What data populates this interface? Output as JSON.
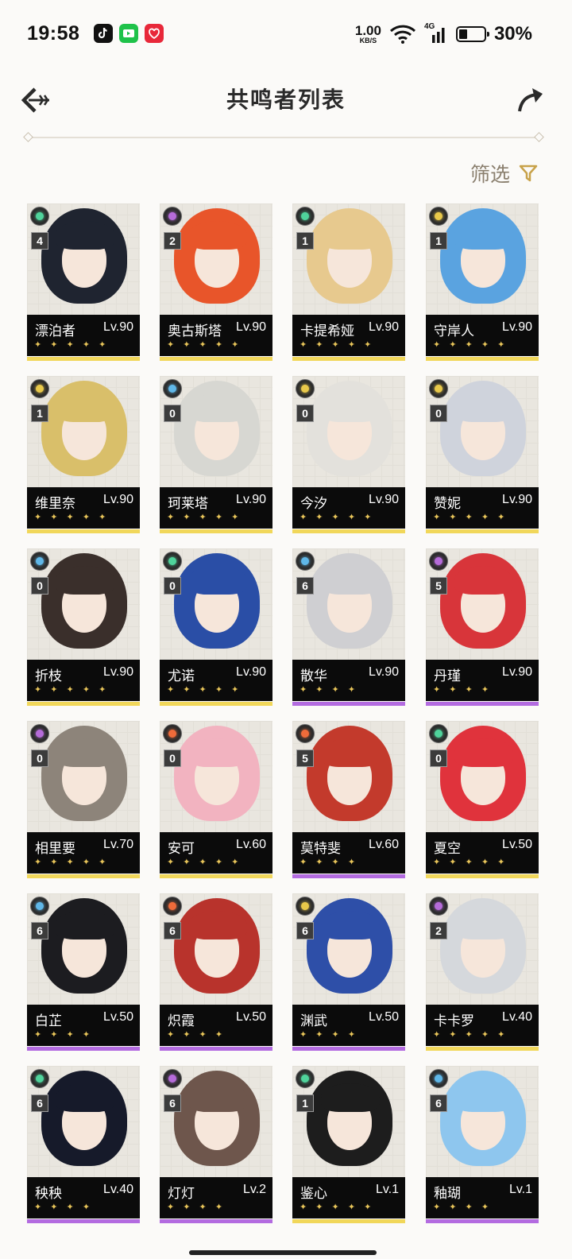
{
  "status": {
    "time": "19:58",
    "speed_value": "1.00",
    "speed_unit": "KB/S",
    "network": "4G",
    "battery": "30%",
    "battery_level": 0.3
  },
  "header": {
    "title": "共鸣者列表",
    "back_icon": "back-arrow-icon",
    "share_icon": "share-icon"
  },
  "filter": {
    "label": "筛选",
    "icon": "filter-icon"
  },
  "colors": {
    "gold_rarity": "#f1d75a",
    "purple_rarity": "#b36be0",
    "accent": "#c8a24a"
  },
  "elements": {
    "aero": "#4fd39b",
    "havoc": "#b56bd9",
    "spectro": "#e8c84a",
    "glacio": "#5fb7e8",
    "fusion": "#ef6b3a"
  },
  "cards": [
    {
      "name": "漂泊者",
      "level": "Lv.90",
      "chain": "4",
      "element": "aero",
      "rarity": "gold",
      "stars": "✦ ✦ ✦ ✦ ✦",
      "hair": "#1f2430"
    },
    {
      "name": "奥古斯塔",
      "level": "Lv.90",
      "chain": "2",
      "element": "havoc",
      "rarity": "gold",
      "stars": "✦ ✦ ✦ ✦ ✦",
      "hair": "#e8552a"
    },
    {
      "name": "卡提希娅",
      "level": "Lv.90",
      "chain": "1",
      "element": "aero",
      "rarity": "gold",
      "stars": "✦ ✦ ✦ ✦ ✦",
      "hair": "#e7c98e"
    },
    {
      "name": "守岸人",
      "level": "Lv.90",
      "chain": "1",
      "element": "spectro",
      "rarity": "gold",
      "stars": "✦ ✦ ✦ ✦ ✦",
      "hair": "#5aa3e0"
    },
    {
      "name": "维里奈",
      "level": "Lv.90",
      "chain": "1",
      "element": "spectro",
      "rarity": "gold",
      "stars": "✦ ✦ ✦ ✦ ✦",
      "hair": "#d9bf6a"
    },
    {
      "name": "珂莱塔",
      "level": "Lv.90",
      "chain": "0",
      "element": "glacio",
      "rarity": "gold",
      "stars": "✦ ✦ ✦ ✦ ✦",
      "hair": "#d7d7d2"
    },
    {
      "name": "今汐",
      "level": "Lv.90",
      "chain": "0",
      "element": "spectro",
      "rarity": "gold",
      "stars": "✦ ✦ ✦ ✦ ✦",
      "hair": "#e3e1dc"
    },
    {
      "name": "赞妮",
      "level": "Lv.90",
      "chain": "0",
      "element": "spectro",
      "rarity": "gold",
      "stars": "✦ ✦ ✦ ✦ ✦",
      "hair": "#cfd3dc"
    },
    {
      "name": "折枝",
      "level": "Lv.90",
      "chain": "0",
      "element": "glacio",
      "rarity": "gold",
      "stars": "✦ ✦ ✦ ✦ ✦",
      "hair": "#3a2f2b"
    },
    {
      "name": "尤诺",
      "level": "Lv.90",
      "chain": "0",
      "element": "aero",
      "rarity": "gold",
      "stars": "✦ ✦ ✦ ✦ ✦",
      "hair": "#2a4ea6"
    },
    {
      "name": "散华",
      "level": "Lv.90",
      "chain": "6",
      "element": "glacio",
      "rarity": "purple",
      "stars": "✦ ✦ ✦ ✦",
      "hair": "#cfcfd2"
    },
    {
      "name": "丹瑾",
      "level": "Lv.90",
      "chain": "5",
      "element": "havoc",
      "rarity": "purple",
      "stars": "✦ ✦ ✦ ✦",
      "hair": "#d8353a"
    },
    {
      "name": "相里要",
      "level": "Lv.70",
      "chain": "0",
      "element": "havoc",
      "rarity": "gold",
      "stars": "✦ ✦ ✦ ✦ ✦",
      "hair": "#8d847a"
    },
    {
      "name": "安可",
      "level": "Lv.60",
      "chain": "0",
      "element": "fusion",
      "rarity": "gold",
      "stars": "✦ ✦ ✦ ✦ ✦",
      "hair": "#f2b3c0"
    },
    {
      "name": "莫特斐",
      "level": "Lv.60",
      "chain": "5",
      "element": "fusion",
      "rarity": "purple",
      "stars": "✦ ✦ ✦ ✦",
      "hair": "#c33a2c"
    },
    {
      "name": "夏空",
      "level": "Lv.50",
      "chain": "0",
      "element": "aero",
      "rarity": "gold",
      "stars": "✦ ✦ ✦ ✦ ✦",
      "hair": "#e0333c"
    },
    {
      "name": "白芷",
      "level": "Lv.50",
      "chain": "6",
      "element": "glacio",
      "rarity": "purple",
      "stars": "✦ ✦ ✦ ✦",
      "hair": "#1c1c20"
    },
    {
      "name": "炽霞",
      "level": "Lv.50",
      "chain": "6",
      "element": "fusion",
      "rarity": "purple",
      "stars": "✦ ✦ ✦ ✦",
      "hair": "#b8332c"
    },
    {
      "name": "渊武",
      "level": "Lv.50",
      "chain": "6",
      "element": "spectro",
      "rarity": "purple",
      "stars": "✦ ✦ ✦ ✦",
      "hair": "#2e4fa8"
    },
    {
      "name": "卡卡罗",
      "level": "Lv.40",
      "chain": "2",
      "element": "havoc",
      "rarity": "gold",
      "stars": "✦ ✦ ✦ ✦ ✦",
      "hair": "#d5d8dc"
    },
    {
      "name": "秧秧",
      "level": "Lv.40",
      "chain": "6",
      "element": "aero",
      "rarity": "purple",
      "stars": "✦ ✦ ✦ ✦",
      "hair": "#161a2a"
    },
    {
      "name": "灯灯",
      "level": "Lv.2",
      "chain": "6",
      "element": "havoc",
      "rarity": "purple",
      "stars": "✦ ✦ ✦ ✦",
      "hair": "#6e564c"
    },
    {
      "name": "鉴心",
      "level": "Lv.1",
      "chain": "1",
      "element": "aero",
      "rarity": "gold",
      "stars": "✦ ✦ ✦ ✦ ✦",
      "hair": "#1d1d1d"
    },
    {
      "name": "釉瑚",
      "level": "Lv.1",
      "chain": "6",
      "element": "glacio",
      "rarity": "purple",
      "stars": "✦ ✦ ✦ ✦",
      "hair": "#8ec6ee"
    }
  ]
}
